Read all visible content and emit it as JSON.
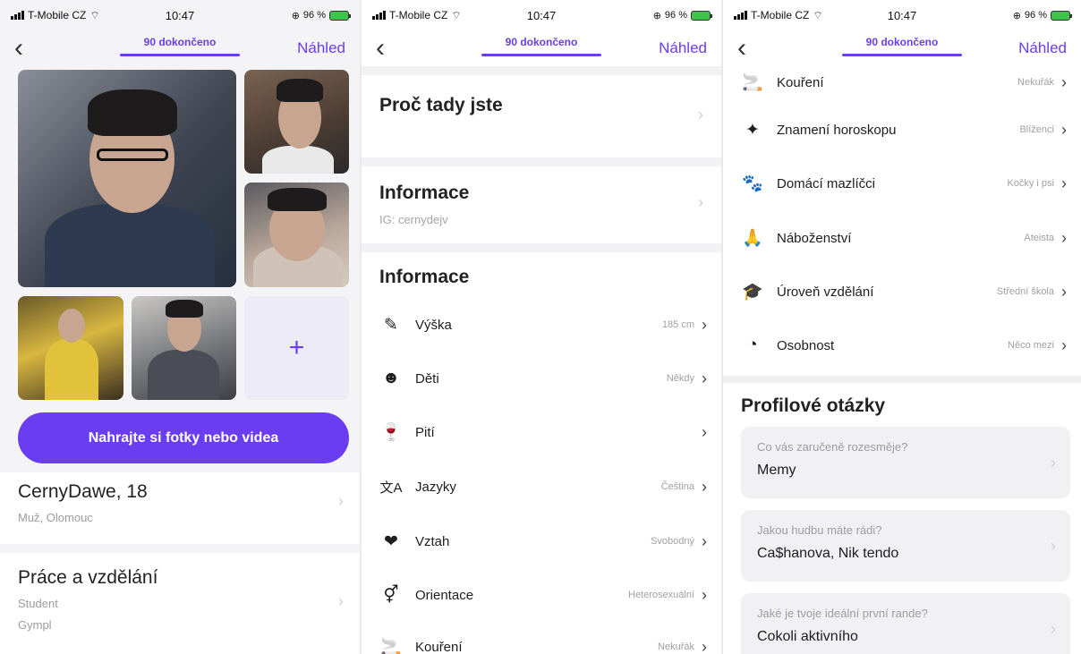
{
  "status": {
    "carrier": "T-Mobile CZ",
    "time": "10:47",
    "battery": "96 %"
  },
  "nav": {
    "progress": "90 dokončeno",
    "preview": "Náhled",
    "back": "‹"
  },
  "screen1": {
    "upload_button": "Nahrajte si fotky nebo videa",
    "add_symbol": "+",
    "profile": {
      "name": "CernyDawe, 18",
      "details": "Muž, Olomouc"
    },
    "work": {
      "title": "Práce a vzdělání",
      "line1": "Student",
      "line2": "Gympl"
    }
  },
  "screen2": {
    "why": {
      "title": "Proč tady jste"
    },
    "info1": {
      "title": "Informace",
      "sub": "IG: cernydejv"
    },
    "info2": {
      "title": "Informace"
    },
    "rows": [
      {
        "icon": "ruler-icon",
        "glyph": "✎",
        "label": "Výška",
        "value": "185 cm"
      },
      {
        "icon": "child-face-icon",
        "glyph": "☻",
        "label": "Děti",
        "value": "Někdy"
      },
      {
        "icon": "wine-glass-icon",
        "glyph": "🍷",
        "label": "Pití",
        "value": ""
      },
      {
        "icon": "translate-icon",
        "glyph": "文A",
        "label": "Jazyky",
        "value": "Čeština"
      },
      {
        "icon": "heart-icon",
        "glyph": "❤",
        "label": "Vztah",
        "value": "Svobodný"
      },
      {
        "icon": "gender-icon",
        "glyph": "⚥",
        "label": "Orientace",
        "value": "Heterosexuální"
      },
      {
        "icon": "smoking-icon",
        "glyph": "🚬",
        "label": "Kouření",
        "value": "Nekuřák"
      }
    ]
  },
  "screen3": {
    "rows": [
      {
        "icon": "smoking-icon",
        "glyph": "🚬",
        "label": "Kouření",
        "value": "Nekuřák"
      },
      {
        "icon": "constellation-icon",
        "glyph": "✦",
        "label": "Znamení horoskopu",
        "value": "Blíženci"
      },
      {
        "icon": "paw-icon",
        "glyph": "🐾",
        "label": "Domácí mazlíčci",
        "value": "Kočky i psi"
      },
      {
        "icon": "praying-hands-icon",
        "glyph": "🙏",
        "label": "Náboženství",
        "value": "Ateista"
      },
      {
        "icon": "graduation-cap-icon",
        "glyph": "🎓",
        "label": "Úroveň vzdělání",
        "value": "Střední škola"
      },
      {
        "icon": "head-silhouette-icon",
        "glyph": "◔",
        "label": "Osobnost",
        "value": "Něco mezi"
      }
    ],
    "questions_title": "Profilové otázky",
    "questions": [
      {
        "q": "Co vás zaručeně rozesměje?",
        "a": "Memy"
      },
      {
        "q": "Jakou hudbu máte rádi?",
        "a": "Ca$hanova, Nik tendo"
      },
      {
        "q": "Jaké je tvoje ideální první rande?",
        "a": "Cokoli aktivního"
      }
    ]
  },
  "chevron": "›"
}
